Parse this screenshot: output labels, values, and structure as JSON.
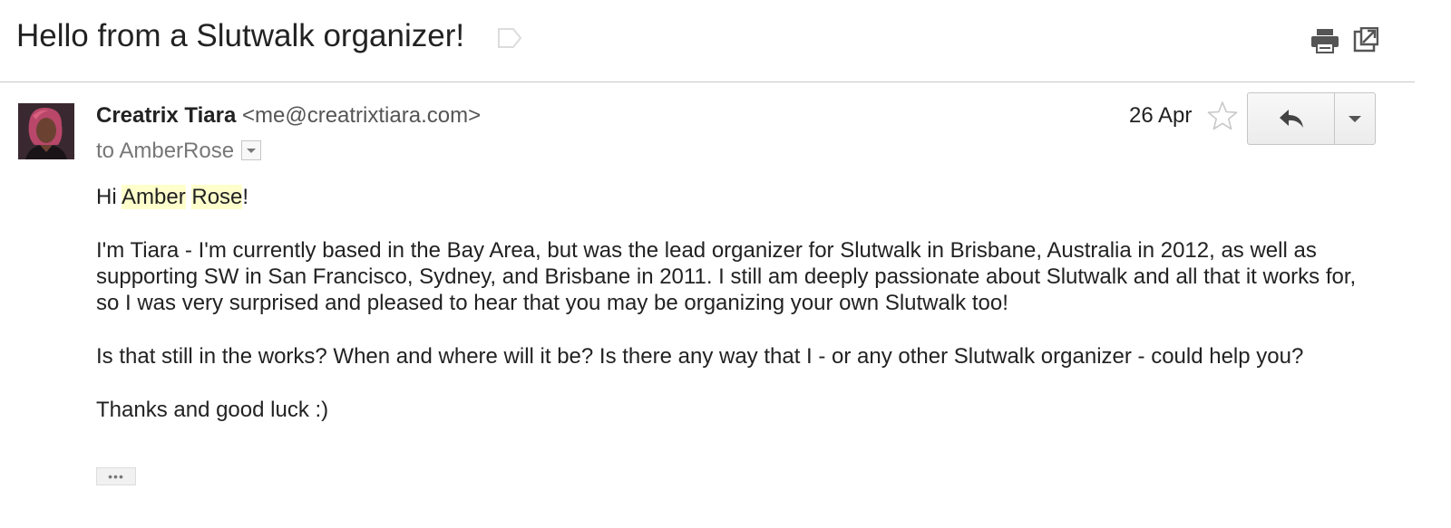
{
  "thread": {
    "subject": "Hello from a Slutwalk organizer!"
  },
  "message": {
    "sender_name": "Creatrix Tiara",
    "sender_email": "<me@creatrixtiara.com>",
    "recipient_prefix": "to",
    "recipient": "AmberRose",
    "date": "26 Apr",
    "greeting_start": "Hi ",
    "greeting_name_first": "Amber",
    "greeting_name_last": "Rose",
    "greeting_end": "!",
    "paragraphs": [
      "I'm Tiara - I'm currently based in the Bay Area, but was the lead organizer for Slutwalk in Brisbane, Australia in 2012, as well as supporting SW in San Francisco, Sydney, and Brisbane in 2011. I still am deeply passionate about Slutwalk and all that it works for, so I was very surprised and pleased to hear that you may be organizing your own Slutwalk too!",
      "Is that still in the works? When and where will it be? Is there any way that I - or any other Slutwalk organizer - could help you?",
      "Thanks and good luck :)"
    ],
    "trimmed_content_label": "•••"
  },
  "icons": {
    "label": "label-tag-icon",
    "print": "printer-icon",
    "new_window": "new-window-icon",
    "star": "star-outline-icon",
    "reply": "reply-arrow-icon",
    "more": "chevron-down-icon"
  },
  "colors": {
    "highlight": "#ffffcc",
    "text": "#222222",
    "muted": "#777777"
  }
}
